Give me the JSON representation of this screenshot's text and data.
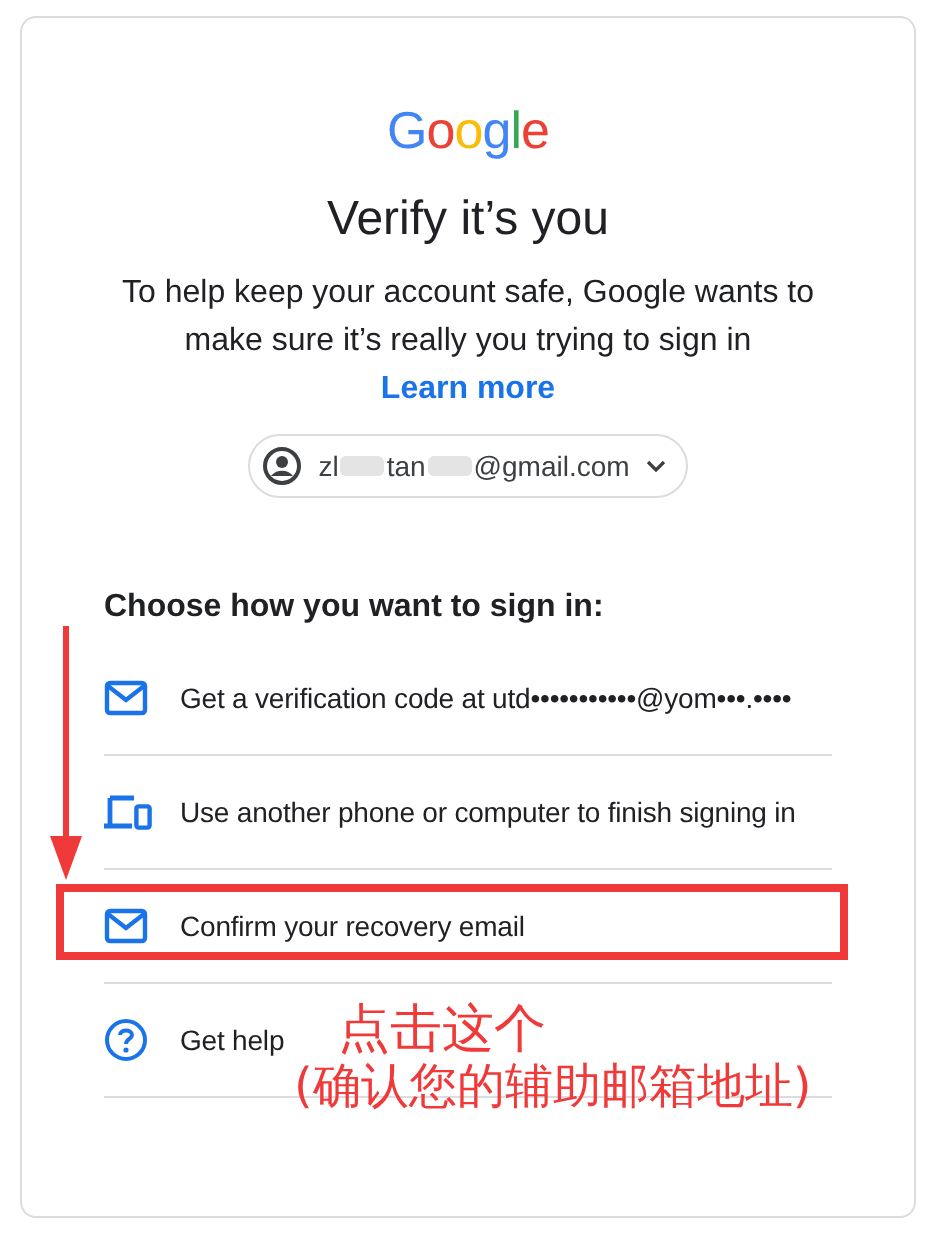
{
  "logo": "Google",
  "title": "Verify it’s you",
  "description": "To help keep your account safe, Google wants to make sure it’s really you trying to sign in",
  "learn_more": "Learn more",
  "account": {
    "email_parts": [
      "zl",
      "tan",
      "@gmail.com"
    ]
  },
  "choose_label": "Choose how you want to sign in:",
  "options": [
    {
      "kind": "email",
      "label": "Get a verification code at utd•••••••••••@yom•••.••••",
      "highlighted": false
    },
    {
      "kind": "devices",
      "label": "Use another phone or computer to finish signing in",
      "highlighted": false
    },
    {
      "kind": "email",
      "label": "Confirm your recovery email",
      "highlighted": true
    },
    {
      "kind": "help",
      "label": "Get help",
      "highlighted": false
    }
  ],
  "annotation": {
    "lines": [
      "点击这个",
      "(确认您的辅助邮箱地址)"
    ]
  }
}
